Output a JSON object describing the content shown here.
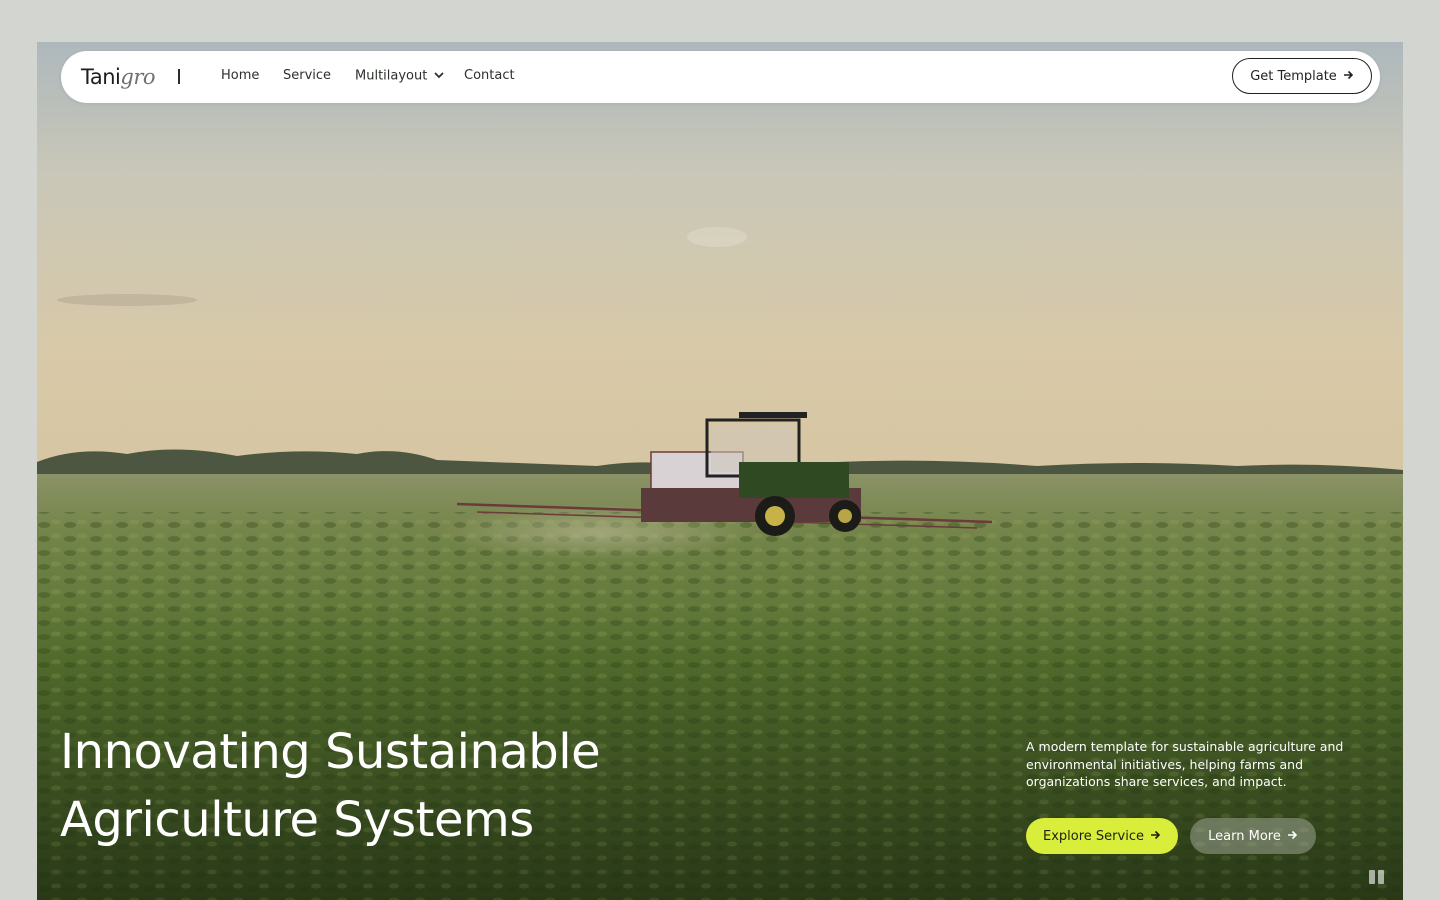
{
  "nav": {
    "logo_part1": "Tani",
    "logo_part2": "gro",
    "links": [
      "Home",
      "Service",
      "Multilayout",
      "Contact"
    ],
    "cta_label": "Get Template"
  },
  "hero": {
    "title_line1": "Innovating Sustainable",
    "title_line2": "Agriculture Systems",
    "description": "A modern template for sustainable agriculture and environmental initiatives, helping farms and organizations share services, and impact.",
    "primary_button": "Explore Service",
    "secondary_button": "Learn More"
  },
  "colors": {
    "accent": "#d9ee3a",
    "nav_bg": "#ffffff",
    "text_dark": "#1f231e"
  },
  "icons": {
    "arrow": "arrow-right-icon",
    "dropdown": "chevron-down-icon",
    "video": "pause-icon"
  }
}
